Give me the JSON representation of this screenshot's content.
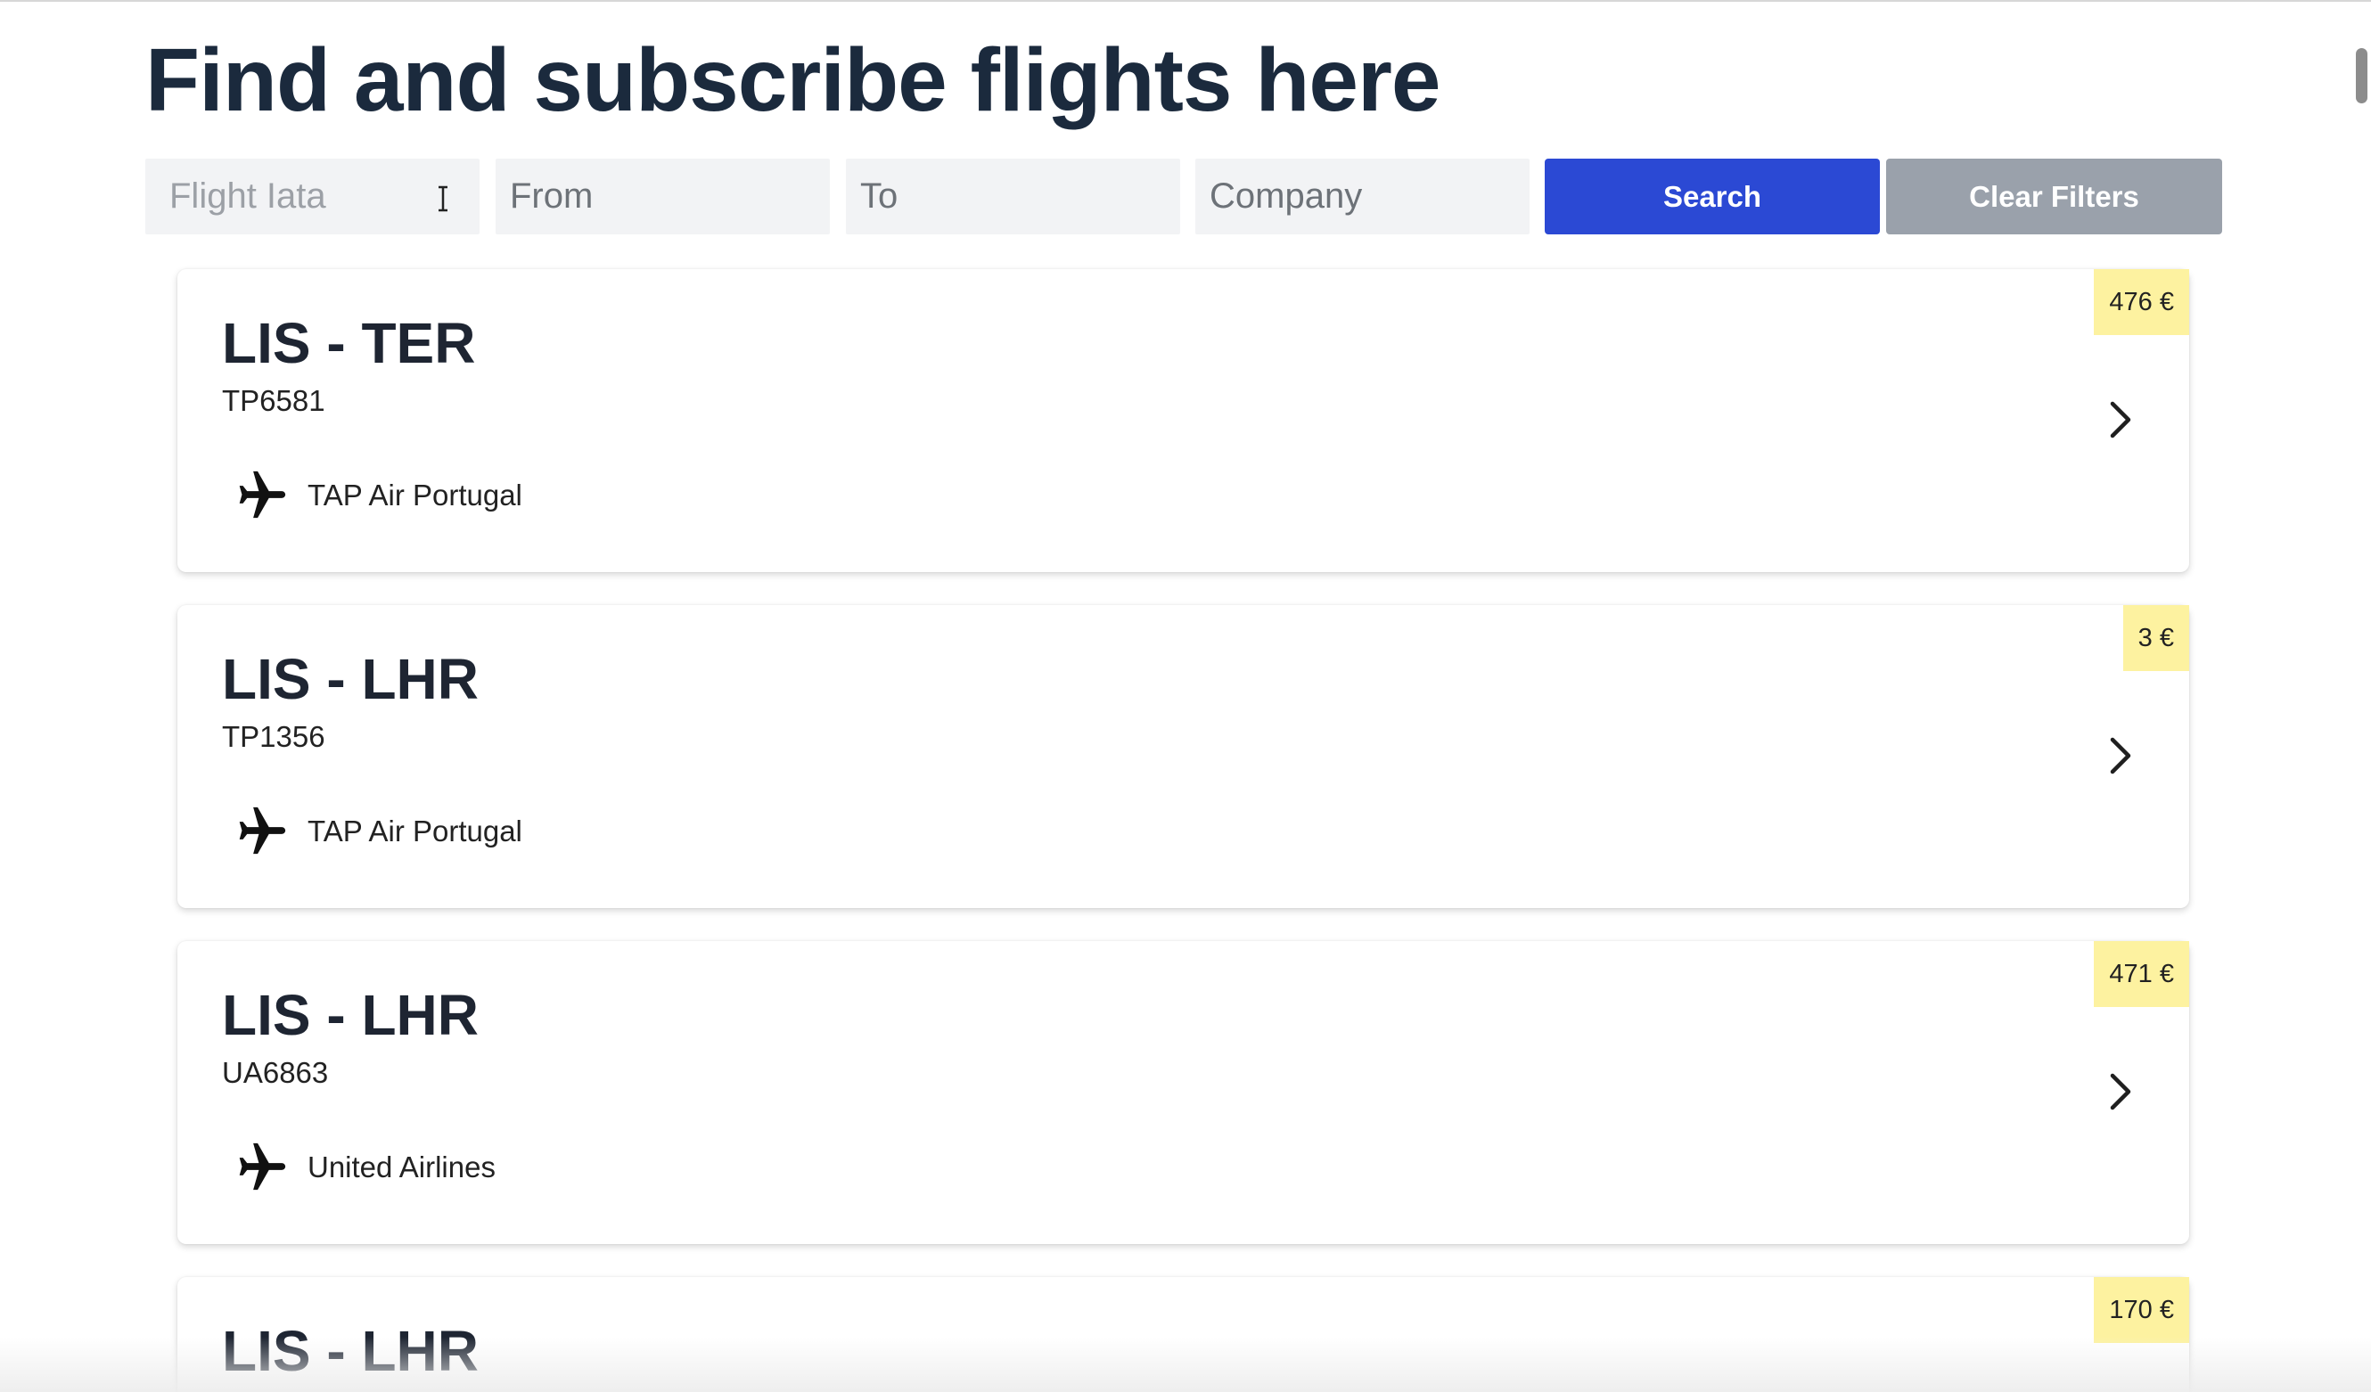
{
  "page": {
    "title": "Find and subscribe flights here"
  },
  "filters": {
    "iata_placeholder": "Flight Iata",
    "from_placeholder": "From",
    "to_placeholder": "To",
    "company_placeholder": "Company",
    "search_label": "Search",
    "clear_label": "Clear Filters"
  },
  "flights": [
    {
      "route": "LIS - TER",
      "code": "TP6581",
      "company": "TAP Air Portugal",
      "price": "476 €",
      "icon": "airplane-icon"
    },
    {
      "route": "LIS - LHR",
      "code": "TP1356",
      "company": "TAP Air Portugal",
      "price": "3 €",
      "icon": "airplane-icon"
    },
    {
      "route": "LIS - LHR",
      "code": "UA6863",
      "company": "United Airlines",
      "price": "471 €",
      "icon": "airplane-icon"
    },
    {
      "route": "LIS - LHR",
      "price": "170 €"
    }
  ],
  "colors": {
    "accent": "#2b49d4",
    "clear_button": "#9aa1ab",
    "price_badge": "#fdf2a0",
    "title": "#1b2a3d"
  }
}
